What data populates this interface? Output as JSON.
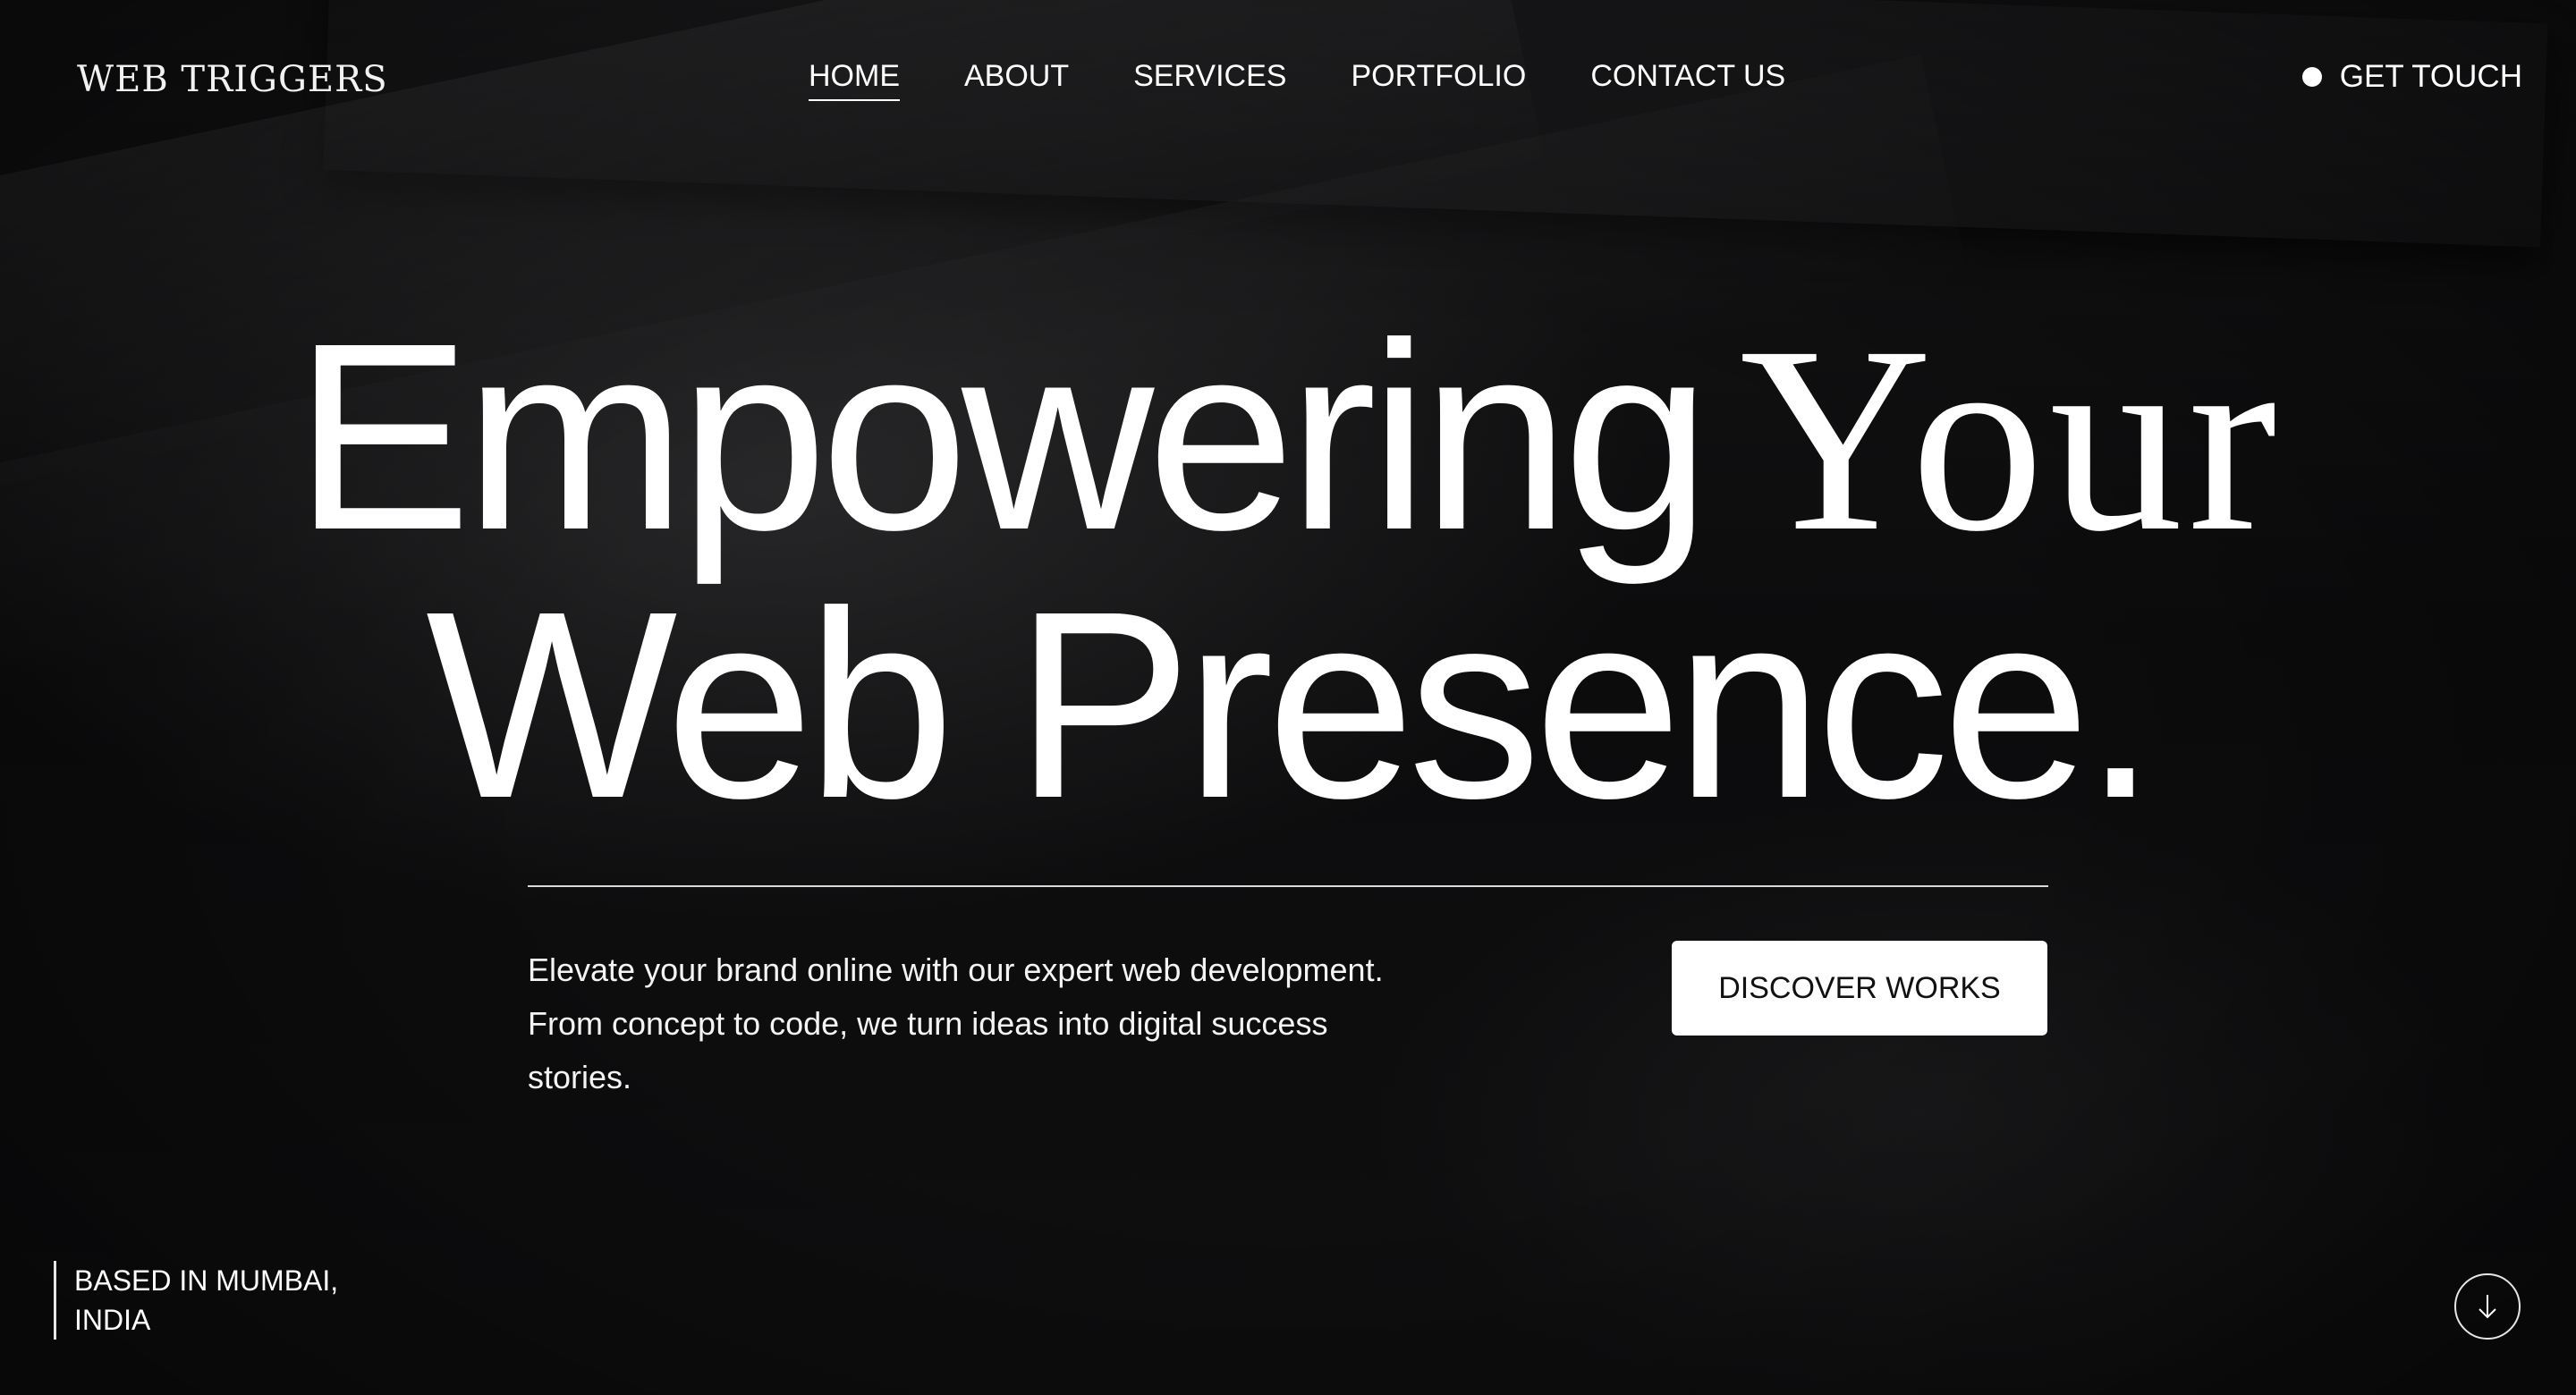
{
  "header": {
    "logo_text": "WEB TRIGGERS",
    "nav": [
      {
        "label": "HOME",
        "active": true
      },
      {
        "label": "ABOUT",
        "active": false
      },
      {
        "label": "SERVICES",
        "active": false
      },
      {
        "label": "PORTFOLIO",
        "active": false
      },
      {
        "label": "CONTACT US",
        "active": false
      }
    ],
    "cta_label": "GET TOUCH"
  },
  "hero": {
    "line1_sans": "Empowering",
    "line1_serif": "Your",
    "line2": "Web Presence.",
    "description": "Elevate your brand online with our expert web development. From concept to code, we turn ideas into digital success stories.",
    "button_label": "DISCOVER WORKS"
  },
  "footer": {
    "location_line1": "BASED IN MUMBAI,",
    "location_line2": "INDIA",
    "scroll_icon": "arrow-down-icon"
  },
  "colors": {
    "background": "#0b0b0c",
    "text": "#ffffff",
    "button_bg": "#ffffff",
    "button_text": "#111111"
  }
}
